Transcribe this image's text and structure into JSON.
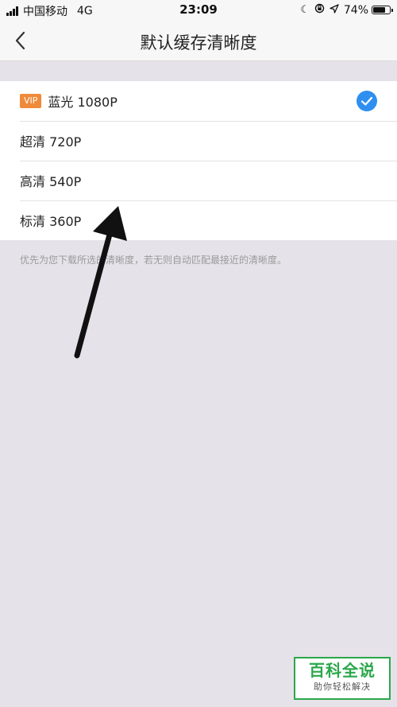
{
  "status_bar": {
    "carrier": "中国移动",
    "network": "4G",
    "time": "23:09",
    "battery_percent": "74%",
    "battery_level": 0.74,
    "icons": [
      "signal-icon",
      "moon-icon",
      "lock-rotation-icon",
      "location-arrow-icon",
      "battery-icon"
    ]
  },
  "nav": {
    "title": "默认缓存清晰度",
    "back_icon": "chevron-left-icon"
  },
  "options": [
    {
      "badge": "VIP",
      "label": "蓝光 1080P",
      "selected": true
    },
    {
      "label": "超清 720P",
      "selected": false
    },
    {
      "label": "高清 540P",
      "selected": false
    },
    {
      "label": "标清 360P",
      "selected": false
    }
  ],
  "hint": "优先为您下载所选的清晰度，若无则自动匹配最接近的清晰度。",
  "colors": {
    "vip_badge": "#f08a3a",
    "check": "#2f8ff0",
    "background": "#e6e2e9",
    "watermark": "#2aa84a"
  },
  "watermark": {
    "title": "百科全说",
    "subtitle": "助你轻松解决"
  }
}
